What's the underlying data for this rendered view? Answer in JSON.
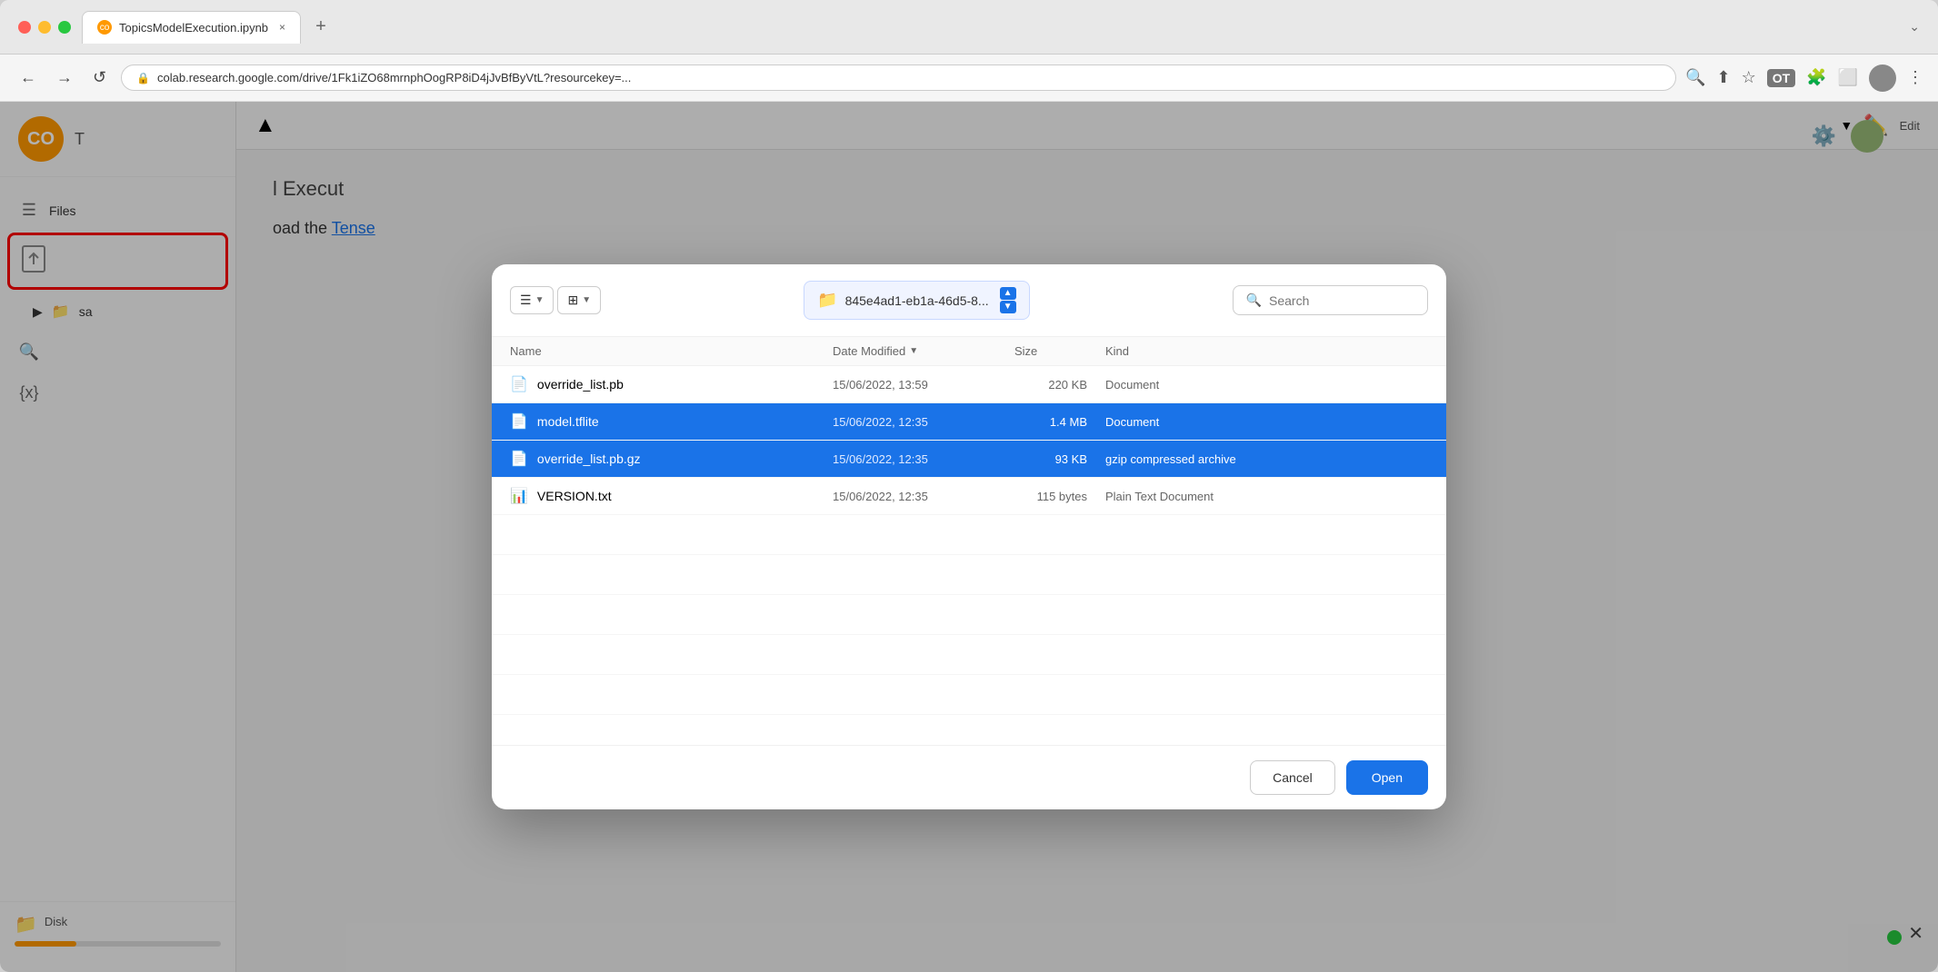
{
  "browser": {
    "tab": {
      "label": "TopicsModelExecution.ipynb",
      "close": "×",
      "new_tab": "+"
    },
    "address": "colab.research.google.com/drive/1Fk1iZO68mrnphOogRP8iD4jJvBfByVtL?resourcekey=...",
    "nav_buttons": {
      "back": "←",
      "forward": "→",
      "reload": "↺"
    }
  },
  "colab": {
    "sidebar": {
      "items": [
        {
          "id": "files",
          "label": "Files",
          "icon": "☰"
        },
        {
          "id": "search",
          "icon": "🔍",
          "label": ""
        },
        {
          "id": "variables",
          "icon": "{x}",
          "label": ""
        }
      ],
      "upload_icon": "⬆",
      "upload_label": "Upload",
      "sa_label": "sa",
      "disk_label": "Disk"
    },
    "header": {
      "title": "T",
      "edit_label": "Edit"
    },
    "content": {
      "line1": "l Execut",
      "line2": "oad the",
      "link_text": "Tense"
    }
  },
  "modal": {
    "view_buttons": [
      {
        "id": "list-view",
        "icon": "☰",
        "label": ""
      },
      {
        "id": "grid-view",
        "icon": "⊞",
        "label": ""
      }
    ],
    "breadcrumb": {
      "folder_name": "845e4ad1-eb1a-46d5-8...",
      "icon": "📁"
    },
    "search": {
      "placeholder": "Search",
      "icon": "🔍"
    },
    "columns": [
      {
        "id": "name",
        "label": "Name",
        "sortable": true
      },
      {
        "id": "date-modified",
        "label": "Date Modified",
        "sortable": true
      },
      {
        "id": "size",
        "label": "Size",
        "sortable": false
      },
      {
        "id": "kind",
        "label": "Kind",
        "sortable": false
      }
    ],
    "files": [
      {
        "id": "override-list-pb",
        "name": "override_list.pb",
        "date": "15/06/2022, 13:59",
        "size": "220 KB",
        "kind": "Document",
        "selected": false,
        "icon": "📄"
      },
      {
        "id": "model-tflite",
        "name": "model.tflite",
        "date": "15/06/2022, 12:35",
        "size": "1.4 MB",
        "kind": "Document",
        "selected": true,
        "icon": "📄"
      },
      {
        "id": "override-list-pb-gz",
        "name": "override_list.pb.gz",
        "date": "15/06/2022, 12:35",
        "size": "93 KB",
        "kind": "gzip compressed archive",
        "selected": true,
        "icon": "📄"
      },
      {
        "id": "version-txt",
        "name": "VERSION.txt",
        "date": "15/06/2022, 12:35",
        "size": "115 bytes",
        "kind": "Plain Text Document",
        "selected": false,
        "icon": "📊"
      }
    ],
    "empty_rows": 5,
    "footer": {
      "cancel_label": "Cancel",
      "open_label": "Open"
    }
  }
}
